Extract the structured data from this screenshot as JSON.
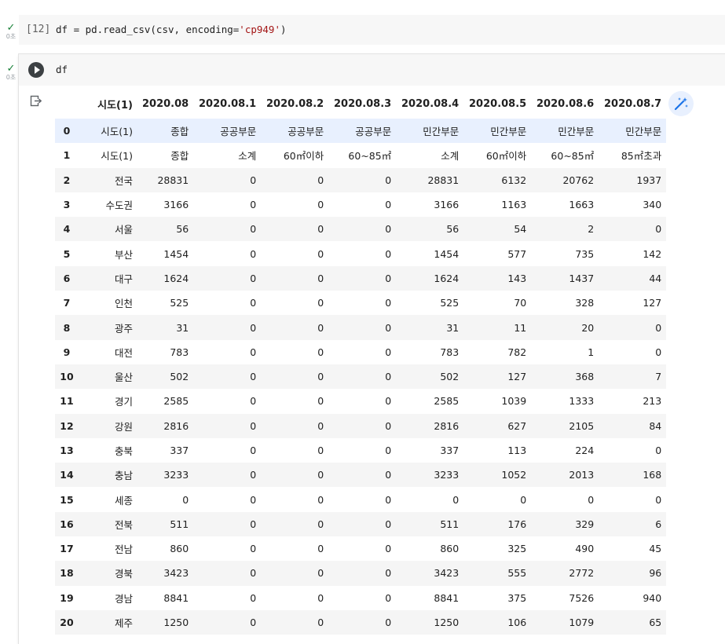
{
  "cell1": {
    "status_check": "✓",
    "status_time": "0초",
    "exec_count": "[12]",
    "code_prefix": "df = pd.read_csv(csv, encoding=",
    "code_string": "'cp949'",
    "code_suffix": ")"
  },
  "cell2": {
    "status_check": "✓",
    "status_time": "0초",
    "code": "df",
    "run_icon": "play-icon",
    "output_icon": "output-redirect-icon",
    "magic_icon": "magic-wand-icon",
    "accent": "#1a73e8"
  },
  "table": {
    "columns": [
      "시도(1)",
      "2020.08",
      "2020.08.1",
      "2020.08.2",
      "2020.08.3",
      "2020.08.4",
      "2020.08.5",
      "2020.08.6",
      "2020.08.7"
    ],
    "rows": [
      {
        "idx": "0",
        "cells": [
          "시도(1)",
          "종합",
          "공공부문",
          "공공부문",
          "공공부문",
          "민간부문",
          "민간부문",
          "민간부문",
          "민간부문"
        ]
      },
      {
        "idx": "1",
        "cells": [
          "시도(1)",
          "종합",
          "소계",
          "60㎡이하",
          "60~85㎡",
          "소계",
          "60㎡이하",
          "60~85㎡",
          "85㎡초과"
        ]
      },
      {
        "idx": "2",
        "cells": [
          "전국",
          "28831",
          "0",
          "0",
          "0",
          "28831",
          "6132",
          "20762",
          "1937"
        ]
      },
      {
        "idx": "3",
        "cells": [
          "수도권",
          "3166",
          "0",
          "0",
          "0",
          "3166",
          "1163",
          "1663",
          "340"
        ]
      },
      {
        "idx": "4",
        "cells": [
          "서울",
          "56",
          "0",
          "0",
          "0",
          "56",
          "54",
          "2",
          "0"
        ]
      },
      {
        "idx": "5",
        "cells": [
          "부산",
          "1454",
          "0",
          "0",
          "0",
          "1454",
          "577",
          "735",
          "142"
        ]
      },
      {
        "idx": "6",
        "cells": [
          "대구",
          "1624",
          "0",
          "0",
          "0",
          "1624",
          "143",
          "1437",
          "44"
        ]
      },
      {
        "idx": "7",
        "cells": [
          "인천",
          "525",
          "0",
          "0",
          "0",
          "525",
          "70",
          "328",
          "127"
        ]
      },
      {
        "idx": "8",
        "cells": [
          "광주",
          "31",
          "0",
          "0",
          "0",
          "31",
          "11",
          "20",
          "0"
        ]
      },
      {
        "idx": "9",
        "cells": [
          "대전",
          "783",
          "0",
          "0",
          "0",
          "783",
          "782",
          "1",
          "0"
        ]
      },
      {
        "idx": "10",
        "cells": [
          "울산",
          "502",
          "0",
          "0",
          "0",
          "502",
          "127",
          "368",
          "7"
        ]
      },
      {
        "idx": "11",
        "cells": [
          "경기",
          "2585",
          "0",
          "0",
          "0",
          "2585",
          "1039",
          "1333",
          "213"
        ]
      },
      {
        "idx": "12",
        "cells": [
          "강원",
          "2816",
          "0",
          "0",
          "0",
          "2816",
          "627",
          "2105",
          "84"
        ]
      },
      {
        "idx": "13",
        "cells": [
          "충북",
          "337",
          "0",
          "0",
          "0",
          "337",
          "113",
          "224",
          "0"
        ]
      },
      {
        "idx": "14",
        "cells": [
          "충남",
          "3233",
          "0",
          "0",
          "0",
          "3233",
          "1052",
          "2013",
          "168"
        ]
      },
      {
        "idx": "15",
        "cells": [
          "세종",
          "0",
          "0",
          "0",
          "0",
          "0",
          "0",
          "0",
          "0"
        ]
      },
      {
        "idx": "16",
        "cells": [
          "전북",
          "511",
          "0",
          "0",
          "0",
          "511",
          "176",
          "329",
          "6"
        ]
      },
      {
        "idx": "17",
        "cells": [
          "전남",
          "860",
          "0",
          "0",
          "0",
          "860",
          "325",
          "490",
          "45"
        ]
      },
      {
        "idx": "18",
        "cells": [
          "경북",
          "3423",
          "0",
          "0",
          "0",
          "3423",
          "555",
          "2772",
          "96"
        ]
      },
      {
        "idx": "19",
        "cells": [
          "경남",
          "8841",
          "0",
          "0",
          "0",
          "8841",
          "375",
          "7526",
          "940"
        ]
      },
      {
        "idx": "20",
        "cells": [
          "제주",
          "1250",
          "0",
          "0",
          "0",
          "1250",
          "106",
          "1079",
          "65"
        ]
      }
    ]
  }
}
